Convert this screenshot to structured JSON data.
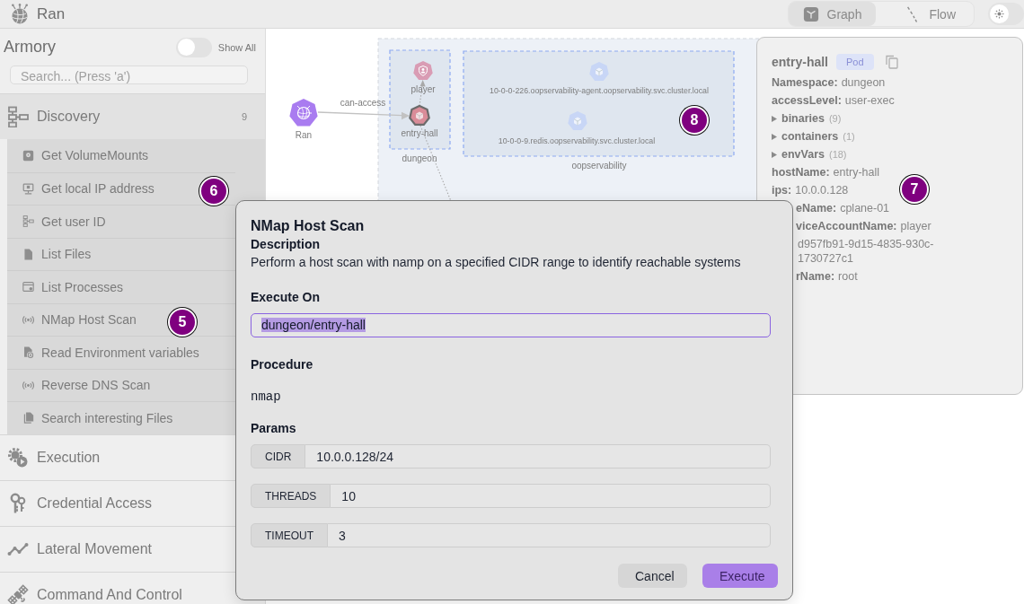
{
  "app": {
    "title": "Ran"
  },
  "view_switch": [
    {
      "label": "Graph",
      "selected": true
    },
    {
      "label": "Flow",
      "selected": false
    }
  ],
  "theme_toggle": {
    "dark": false
  },
  "sidebar": {
    "title": "Armory",
    "show_all": {
      "label": "Show All",
      "on": false
    },
    "search": {
      "placeholder": "Search... (Press 'a')"
    },
    "categories": [
      {
        "name": "Discovery",
        "count": "9",
        "expanded": true,
        "children": [
          {
            "label": "Get VolumeMounts"
          },
          {
            "label": "Get local IP address"
          },
          {
            "label": "Get user ID"
          },
          {
            "label": "List Files"
          },
          {
            "label": "List Processes"
          },
          {
            "label": "NMap Host Scan"
          },
          {
            "label": "Read Environment variables"
          },
          {
            "label": "Reverse DNS Scan"
          },
          {
            "label": "Search interesting Files"
          }
        ]
      },
      {
        "name": "Execution",
        "expanded": false
      },
      {
        "name": "Credential Access",
        "expanded": false
      },
      {
        "name": "Lateral Movement",
        "expanded": false
      },
      {
        "name": "Command And Control",
        "expanded": false
      }
    ]
  },
  "graph": {
    "groups": [
      {
        "label": "dungeon"
      },
      {
        "label": "oopservability"
      }
    ],
    "nodes": [
      {
        "label": "Ran",
        "kind": "origin",
        "color": "#a97cf0",
        "selected": false
      },
      {
        "label": "player",
        "kind": "account",
        "color": "#d99cb4",
        "selected": false
      },
      {
        "label": "entry-hall",
        "kind": "pod",
        "color": "#d98c98",
        "selected": true
      },
      {
        "label": "10-0-0-226.oopservability-agent.oopservability.svc.cluster.local",
        "kind": "pod",
        "color": "#c8d6f6",
        "selected": false
      },
      {
        "label": "10-0-0-9.redis.oopservability.svc.cluster.local",
        "kind": "pod",
        "color": "#c8d6f6",
        "selected": false
      }
    ],
    "edges": [
      {
        "label": "can-access",
        "kind": "solid"
      },
      {
        "kind": "dotted"
      },
      {
        "kind": "dotted"
      }
    ]
  },
  "details": {
    "title": "entry-hall",
    "badge": "Pod",
    "properties": [
      {
        "kind": "field",
        "key": "Namespace:",
        "value": "dungeon"
      },
      {
        "kind": "field",
        "key": "accessLevel:",
        "value": "user-exec"
      },
      {
        "kind": "list",
        "key": "binaries",
        "count": "(9)",
        "expanded": false
      },
      {
        "kind": "list",
        "key": "containers",
        "count": "(1)",
        "expanded": false
      },
      {
        "kind": "list",
        "key": "envVars",
        "count": "(18)",
        "expanded": false
      },
      {
        "kind": "field",
        "key": "hostName:",
        "value": "entry-hall"
      },
      {
        "kind": "field",
        "key": "ips:",
        "value": "10.0.0.128"
      }
    ],
    "properties_under_dialog": [
      {
        "key": "eName:",
        "value": "cplane-01"
      },
      {
        "key": "viceAccountName:",
        "value": "player"
      },
      {
        "value_lines": [
          "d957fb91-9d15-4835-930c-",
          "1730727c1"
        ]
      },
      {
        "key": "rName:",
        "value": "root"
      }
    ]
  },
  "dialog": {
    "title": "NMap Host Scan",
    "description_label": "Description",
    "description": "Perform a host scan with namp on a specified CIDR range to identify reachable systems",
    "execute_on": {
      "label": "Execute On",
      "value": "dungeon/entry-hall",
      "value_selected": true
    },
    "procedure": {
      "label": "Procedure",
      "value": "nmap"
    },
    "params": {
      "label": "Params",
      "items": [
        {
          "name": "CIDR",
          "value": "10.0.0.128/24"
        },
        {
          "name": "THREADS",
          "value": "10"
        },
        {
          "name": "TIMEOUT",
          "value": "3"
        }
      ]
    },
    "buttons": [
      {
        "label": "Cancel",
        "kind": "secondary"
      },
      {
        "label": "Execute",
        "kind": "primary"
      }
    ]
  },
  "markers": [
    {
      "label": "8"
    },
    {
      "label": "7"
    },
    {
      "label": "6"
    },
    {
      "label": "5"
    }
  ]
}
